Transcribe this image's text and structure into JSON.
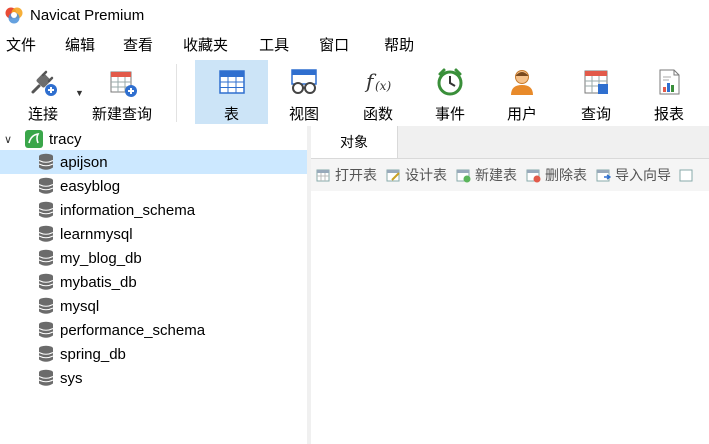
{
  "window": {
    "title": "Navicat Premium"
  },
  "menu": [
    "文件",
    "编辑",
    "查看",
    "收藏夹",
    "工具",
    "窗口",
    "帮助"
  ],
  "toolbar": {
    "connect": "连接",
    "new_query": "新建查询",
    "table": "表",
    "view": "视图",
    "function": "函数",
    "event": "事件",
    "user": "用户",
    "query": "查询",
    "report": "报表"
  },
  "nav": {
    "connection": "tracy",
    "databases": [
      "apijson",
      "easyblog",
      "information_schema",
      "learnmysql",
      "my_blog_db",
      "mybatis_db",
      "mysql",
      "performance_schema",
      "spring_db",
      "sys"
    ],
    "selected": "apijson"
  },
  "objects": {
    "tab": "对象",
    "actions": [
      "打开表",
      "设计表",
      "新建表",
      "删除表",
      "导入向导"
    ]
  }
}
